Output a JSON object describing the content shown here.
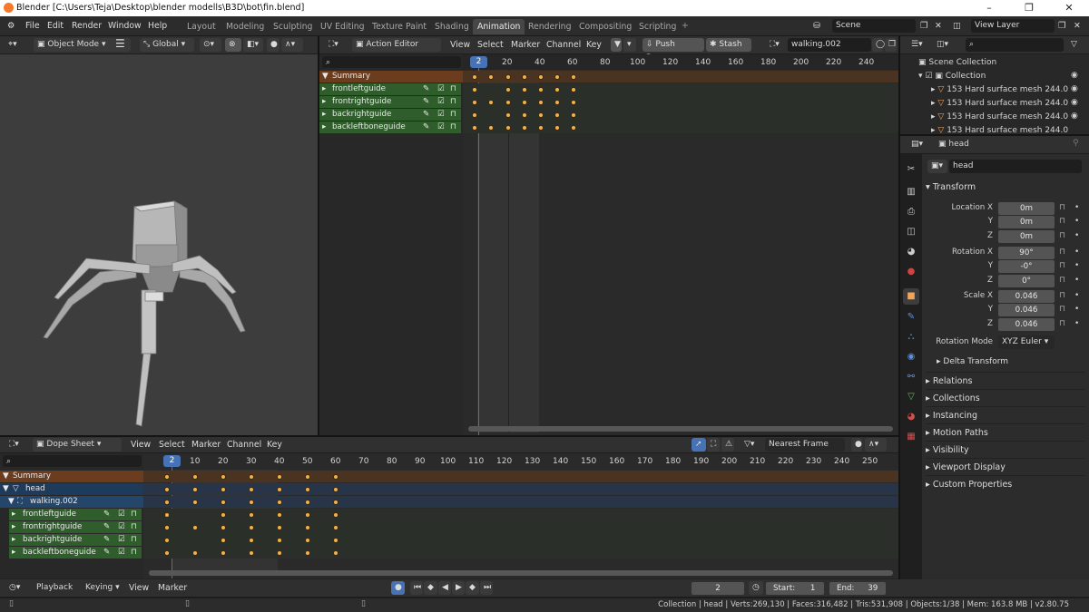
{
  "window": {
    "title": "Blender [C:\\Users\\Teja\\Desktop\\blender modells\\B3D\\bot\\fin.blend]"
  },
  "menu": [
    "File",
    "Edit",
    "Render",
    "Window",
    "Help"
  ],
  "workspaces": [
    "Layout",
    "Modeling",
    "Sculpting",
    "UV Editing",
    "Texture Paint",
    "Shading",
    "Animation",
    "Rendering",
    "Compositing",
    "Scripting"
  ],
  "active_workspace": "Animation",
  "scene": "Scene",
  "view_layer": "View Layer",
  "viewport": {
    "mode": "Object Mode",
    "orientation": "Global"
  },
  "action_editor": {
    "mode": "Action Editor",
    "menus": [
      "View",
      "Select",
      "Marker",
      "Channel",
      "Key"
    ],
    "push_down": "Push Down",
    "stash": "Stash",
    "action": "walking.002",
    "frame_ticks": [
      "2",
      "20",
      "40",
      "60",
      "80",
      "100",
      "120",
      "140",
      "160",
      "180",
      "200",
      "220",
      "240"
    ],
    "summary": "Summary",
    "channels": [
      "frontleftguide",
      "frontrightguide",
      "backrightguide",
      "backleftboneguide"
    ]
  },
  "dope_sheet": {
    "mode": "Dope Sheet",
    "menus": [
      "View",
      "Select",
      "Marker",
      "Channel",
      "Key"
    ],
    "snap": "Nearest Frame",
    "frame_ticks": [
      "2",
      "10",
      "20",
      "30",
      "40",
      "50",
      "60",
      "70",
      "80",
      "90",
      "100",
      "110",
      "120",
      "130",
      "140",
      "150",
      "160",
      "170",
      "180",
      "190",
      "200",
      "210",
      "220",
      "230",
      "240",
      "250"
    ],
    "summary": "Summary",
    "object": "head",
    "action": "walking.002",
    "channels": [
      "frontleftguide",
      "frontrightguide",
      "backrightguide",
      "backleftboneguide"
    ]
  },
  "timeline": {
    "menus": [
      "Playback",
      "Keying",
      "View",
      "Marker"
    ],
    "current_frame": "2",
    "start_label": "Start:",
    "start": "1",
    "end_label": "End:",
    "end": "39"
  },
  "outliner": {
    "scene_collection": "Scene Collection",
    "collection": "Collection",
    "items": [
      "153 Hard surface mesh 244.0",
      "153 Hard surface mesh 244.0",
      "153 Hard surface mesh 244.0",
      "153 Hard surface mesh 244.0"
    ]
  },
  "properties": {
    "object_name": "head",
    "name_field": "head",
    "transform_title": "Transform",
    "location_labels": [
      "Location X",
      "Y",
      "Z"
    ],
    "location": [
      "0m",
      "0m",
      "0m"
    ],
    "rotation_labels": [
      "Rotation X",
      "Y",
      "Z"
    ],
    "rotation": [
      "90°",
      "-0°",
      "0°"
    ],
    "scale_labels": [
      "Scale X",
      "Y",
      "Z"
    ],
    "scale": [
      "0.046",
      "0.046",
      "0.046"
    ],
    "rotation_mode_label": "Rotation Mode",
    "rotation_mode": "XYZ Euler",
    "delta": "Delta Transform",
    "panels": [
      "Relations",
      "Collections",
      "Instancing",
      "Motion Paths",
      "Visibility",
      "Viewport Display",
      "Custom Properties"
    ]
  },
  "status": "Collection | head | Verts:269,130 | Faces:316,482 | Tris:531,908 | Objects:1/38 | Mem: 163.8 MB | v2.80.75",
  "colors": {
    "accent": "#4772b3",
    "keyframe": "#f2b14b",
    "summary": "#6b3c1d",
    "channel_green": "#2f5d2b"
  }
}
